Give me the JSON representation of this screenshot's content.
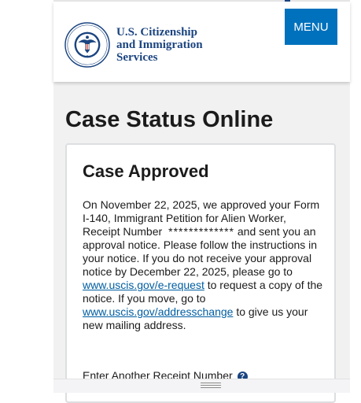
{
  "header": {
    "org_name": [
      "U.S. Citizenship",
      "and Immigration",
      "Services"
    ],
    "seal_lettering": [
      "U.S. DEPARTMENT OF",
      "HOMELAND SECURITY"
    ],
    "menu_label": "MENU"
  },
  "page_title": "Case Status Online",
  "status": {
    "title": "Case Approved",
    "body": {
      "p1": "On November 22, 2025, we approved your Form I-140, Immigrant Petition for Alien Worker, Receipt Number",
      "masked_receipt": "*************",
      "p2": "and sent you an approval notice. Please follow the instructions in your notice. If you do not receive your approval notice by December 22, 2025, please go to",
      "link1": "www.uscis.gov/e-request",
      "p3": "to request a copy of the notice. If you move, go to",
      "link2": "www.uscis.gov/addresschange",
      "p4": "to give us your new mailing address."
    },
    "another_receipt_label": "Enter Another Receipt Number",
    "help_glyph": "?"
  },
  "icons": {
    "seal": "dhs-seal-icon",
    "help": "question-icon",
    "drag": "drag-handle-icon"
  },
  "colors": {
    "brand_navy": "#1a4480",
    "menu_blue": "#0071bc",
    "link_blue": "#005ea2"
  }
}
